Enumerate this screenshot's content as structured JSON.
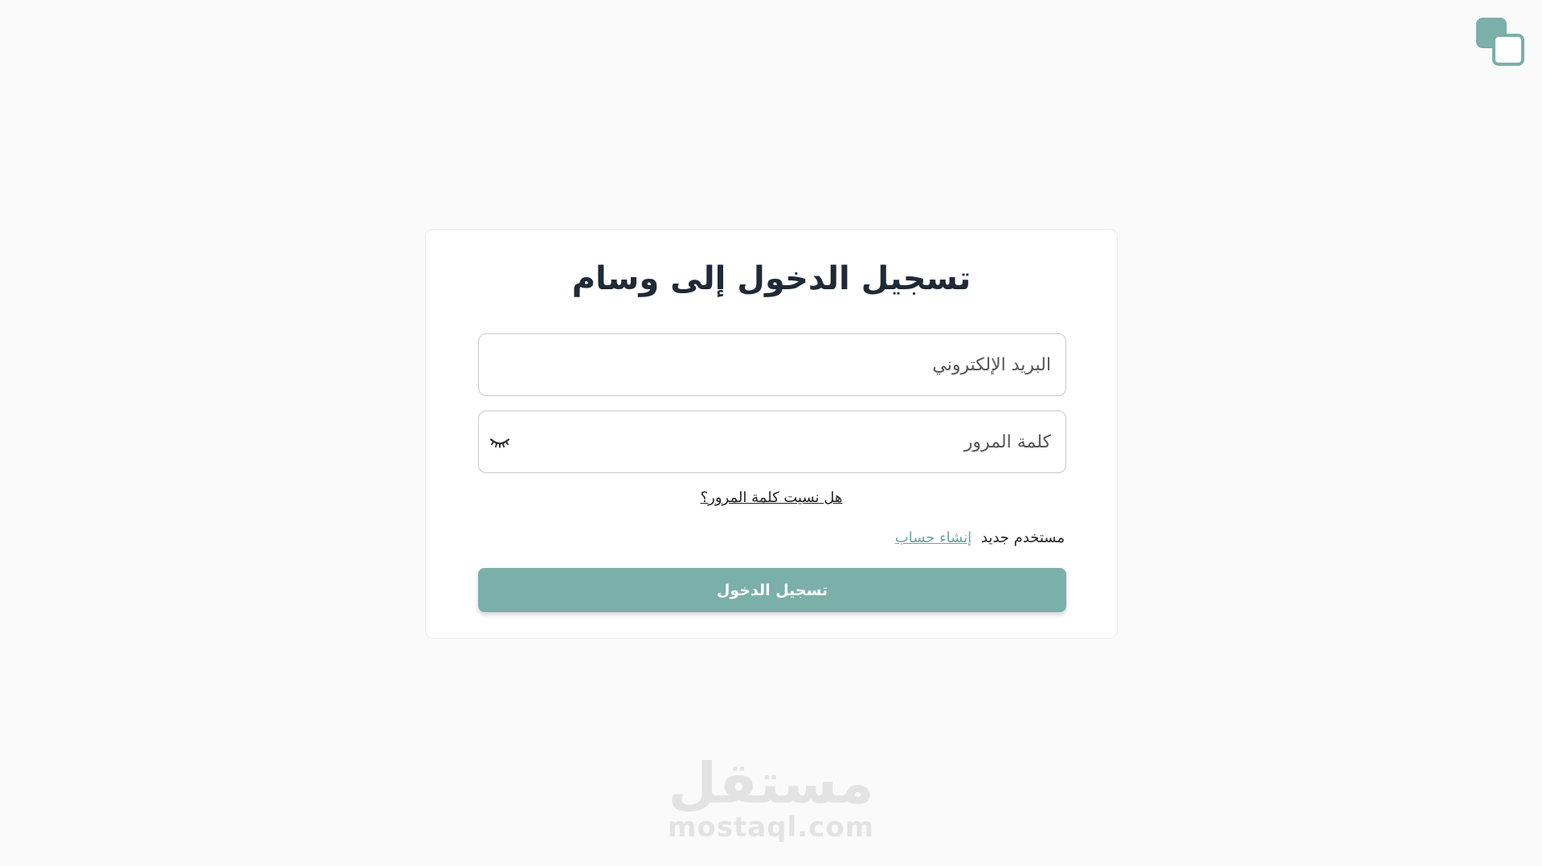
{
  "brand": {
    "accent_color": "#7bafa9",
    "logo_icon": "overlapping-squares-icon"
  },
  "login": {
    "title": "تسجيل الدخول إلى وسام",
    "email": {
      "placeholder": "البريد الإلكتروني",
      "value": ""
    },
    "password": {
      "placeholder": "كلمة المرور",
      "value": "",
      "toggle_icon": "eye-closed-icon"
    },
    "forgot_password": "هل نسيت كلمة المرور؟",
    "new_user_text": "مستخدم جديد",
    "create_account": "إنشاء حساب",
    "submit_label": "تسجيل الدخول"
  },
  "watermark": {
    "arabic": "مستقل",
    "latin": "mostaql.com"
  }
}
